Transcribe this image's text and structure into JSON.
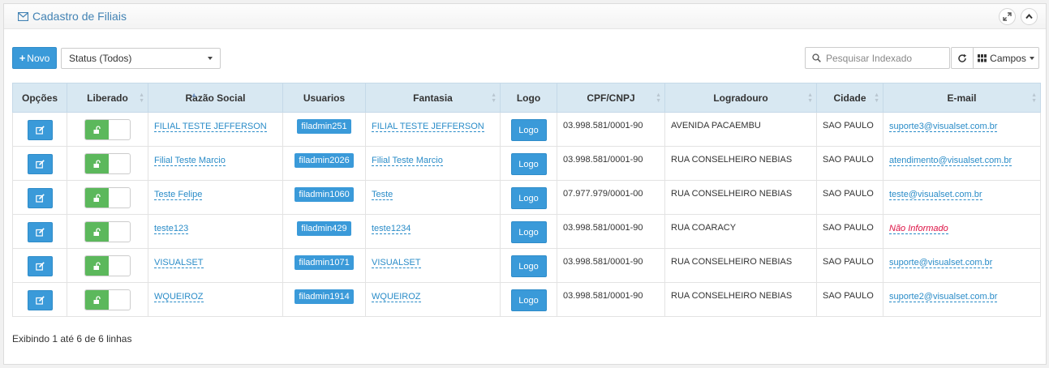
{
  "header": {
    "title": "Cadastro de Filiais",
    "title_icon": "envelope-icon",
    "tools": [
      "expand-icon",
      "chevron-up-icon"
    ]
  },
  "toolbar": {
    "new_label": "Novo",
    "status_value": "Status (Todos)",
    "search_placeholder": "Pesquisar Indexado",
    "campos_label": "Campos"
  },
  "table": {
    "columns": [
      "Opções",
      "Liberado",
      "Razão Social",
      "Usuarios",
      "Fantasia",
      "Logo",
      "CPF/CNPJ",
      "Logradouro",
      "Cidade",
      "E-mail"
    ],
    "logo_label": "Logo",
    "rows": [
      {
        "razao": "FILIAL TESTE JEFFERSON",
        "usuario": "filadmin251",
        "fantasia": "FILIAL TESTE JEFFERSON",
        "cnpj": "03.998.581/0001-90",
        "logradouro": "AVENIDA PACAEMBU",
        "cidade": "SAO PAULO",
        "email": "suporte3@visualset.com.br",
        "email_missing": false
      },
      {
        "razao": "Filial Teste Marcio",
        "usuario": "filadmin2026",
        "fantasia": "Filial Teste Marcio",
        "cnpj": "03.998.581/0001-90",
        "logradouro": "RUA CONSELHEIRO NEBIAS",
        "cidade": "SAO PAULO",
        "email": "atendimento@visualset.com.br",
        "email_missing": false
      },
      {
        "razao": "Teste Felipe",
        "usuario": "filadmin1060",
        "fantasia": "Teste",
        "cnpj": "07.977.979/0001-00",
        "logradouro": "RUA CONSELHEIRO NEBIAS",
        "cidade": "SAO PAULO",
        "email": "teste@visualset.com.br",
        "email_missing": false
      },
      {
        "razao": "teste123",
        "usuario": "filadmin429",
        "fantasia": "teste1234",
        "cnpj": "03.998.581/0001-90",
        "logradouro": "RUA COARACY",
        "cidade": "SAO PAULO",
        "email": "Não Informado",
        "email_missing": true
      },
      {
        "razao": "VISUALSET",
        "usuario": "filadmin1071",
        "fantasia": "VISUALSET",
        "cnpj": "03.998.581/0001-90",
        "logradouro": "RUA CONSELHEIRO NEBIAS",
        "cidade": "SAO PAULO",
        "email": "suporte@visualset.com.br",
        "email_missing": false
      },
      {
        "razao": "WQUEIROZ",
        "usuario": "filadmin1914",
        "fantasia": "WQUEIROZ",
        "cnpj": "03.998.581/0001-90",
        "logradouro": "RUA CONSELHEIRO NEBIAS",
        "cidade": "SAO PAULO",
        "email": "suporte2@visualset.com.br",
        "email_missing": false
      }
    ]
  },
  "footer": {
    "info": "Exibindo 1 até 6 de 6 linhas"
  },
  "colors": {
    "primary": "#3a9ad9",
    "success": "#5cb85c",
    "header_bg": "#d8e8f2",
    "link": "#2a8cc8",
    "missing": "#dd1144"
  }
}
